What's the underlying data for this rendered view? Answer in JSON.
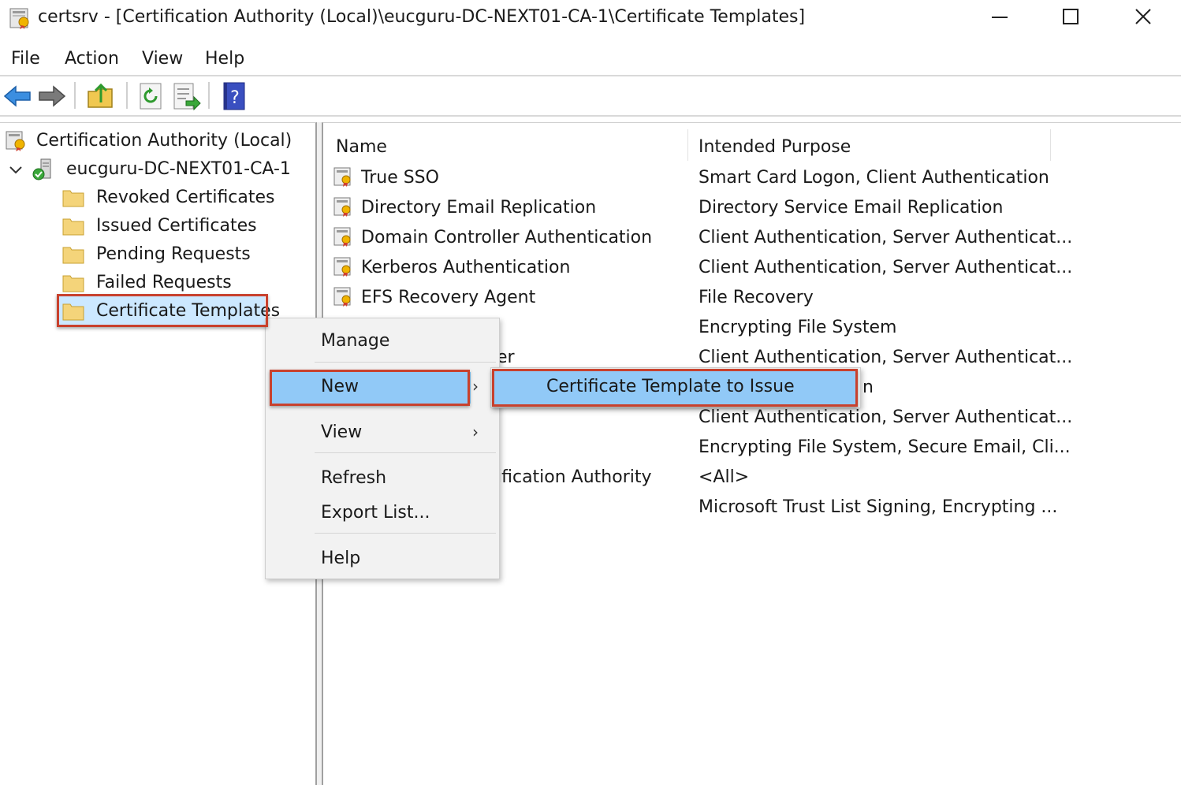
{
  "window": {
    "title": "certsrv - [Certification Authority (Local)\\eucguru-DC-NEXT01-CA-1\\Certificate Templates]",
    "minimize_icon": "minimize-icon",
    "maximize_icon": "maximize-icon",
    "close_icon": "close-icon"
  },
  "menubar": {
    "file": "File",
    "action": "Action",
    "view": "View",
    "help": "Help"
  },
  "toolbar": {
    "buttons": [
      "back-arrow-icon",
      "forward-arrow-icon",
      "up-folder-icon",
      "refresh-icon",
      "export-list-icon",
      "help-book-icon"
    ]
  },
  "tree": {
    "root": "Certification Authority (Local)",
    "ca": "eucguru-DC-NEXT01-CA-1",
    "items": [
      "Revoked Certificates",
      "Issued Certificates",
      "Pending Requests",
      "Failed Requests",
      "Certificate Templates"
    ],
    "selected": "Certificate Templates"
  },
  "list": {
    "columns": {
      "name": "Name",
      "purpose": "Intended Purpose"
    },
    "rows": [
      {
        "name": "True SSO",
        "purpose": "Smart Card Logon, Client Authentication"
      },
      {
        "name": "Directory Email Replication",
        "purpose": "Directory Service Email Replication"
      },
      {
        "name": "Domain Controller Authentication",
        "purpose": "Client Authentication, Server Authenticat..."
      },
      {
        "name": "Kerberos Authentication",
        "purpose": "Client Authentication, Server Authenticat..."
      },
      {
        "name": "EFS Recovery Agent",
        "purpose": "File Recovery"
      },
      {
        "name": "",
        "purpose": "Encrypting File System"
      },
      {
        "name": "er",
        "purpose": "Client Authentication, Server Authenticat..."
      },
      {
        "name": "",
        "purpose": "n"
      },
      {
        "name": "",
        "purpose": "Client Authentication, Server Authenticat..."
      },
      {
        "name": "",
        "purpose": "Encrypting File System, Secure Email, Cli..."
      },
      {
        "name": "ification Authority",
        "purpose": "<All>"
      },
      {
        "name": "",
        "purpose": "Microsoft Trust List Signing, Encrypting ..."
      }
    ]
  },
  "context_menu": {
    "items": {
      "manage": "Manage",
      "new": "New",
      "view": "View",
      "refresh": "Refresh",
      "export": "Export List...",
      "help": "Help"
    },
    "submenu_arrow": "›",
    "active_item": "New"
  },
  "submenu": {
    "item": "Certificate Template to Issue"
  },
  "colors": {
    "highlight_box": "#c8412d",
    "menu_active": "#91c9f7",
    "menu_bg": "#f2f2f2",
    "folder": "#f4d47a"
  }
}
